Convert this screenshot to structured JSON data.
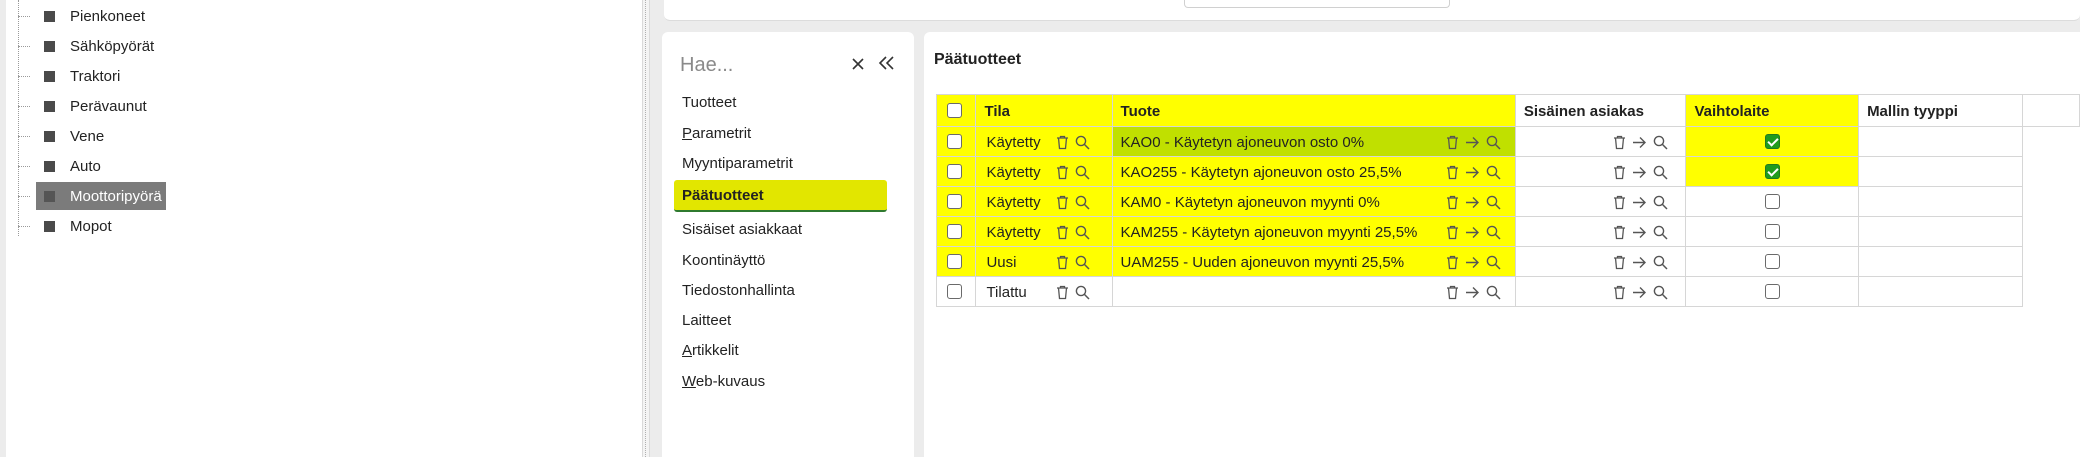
{
  "tree": {
    "items": [
      {
        "label": "Pienkoneet",
        "selected": false
      },
      {
        "label": "Sähköpyörät",
        "selected": false
      },
      {
        "label": "Traktori",
        "selected": false
      },
      {
        "label": "Perävaunut",
        "selected": false
      },
      {
        "label": "Vene",
        "selected": false
      },
      {
        "label": "Auto",
        "selected": false
      },
      {
        "label": "Moottoripyörä",
        "selected": true
      },
      {
        "label": "Mopot",
        "selected": false
      }
    ]
  },
  "nav": {
    "search_placeholder": "Hae...",
    "clear_icon": "close-icon",
    "collapse_icon": "double-chevron-left-icon",
    "items": [
      {
        "label": "Tuotteet"
      },
      {
        "label": "Parametrit",
        "underline_first": true
      },
      {
        "label": "Myyntiparametrit"
      },
      {
        "label": "Päätuotteet",
        "active": true
      },
      {
        "label": "Sisäiset asiakkaat"
      },
      {
        "label": "Koontinäyttö"
      },
      {
        "label": "Tiedostonhallinta"
      },
      {
        "label": "Laitteet"
      },
      {
        "label": "Artikkelit",
        "underline_first": true
      },
      {
        "label": "Web-kuvaus",
        "underline_first": true
      }
    ],
    "active_color": "#e2e600"
  },
  "main": {
    "title": "Päätuotteet",
    "columns": [
      "Tila",
      "Tuote",
      "Sisäinen asiakas",
      "Vaihtolaite",
      "Mallin tyyppi"
    ],
    "rows": [
      {
        "tila": "Käytetty",
        "tuote": "KAO0 - Käytetyn ajoneuvon osto 0%",
        "vaihtolaite": true,
        "highlighted": true
      },
      {
        "tila": "Käytetty",
        "tuote": "KAO255 - Käytetyn ajoneuvon osto 25,5%",
        "vaihtolaite": true,
        "highlighted": true
      },
      {
        "tila": "Käytetty",
        "tuote": "KAM0 - Käytetyn ajoneuvon myynti 0%",
        "vaihtolaite": false,
        "highlighted": true
      },
      {
        "tila": "Käytetty",
        "tuote": "KAM255 - Käytetyn ajoneuvon myynti 25,5%",
        "vaihtolaite": false,
        "highlighted": true
      },
      {
        "tila": "Uusi",
        "tuote": "UAM255 - Uuden ajoneuvon myynti 25,5%",
        "vaihtolaite": false,
        "highlighted": true
      },
      {
        "tila": "Tilattu",
        "tuote": "",
        "vaihtolaite": false,
        "highlighted": false
      }
    ],
    "highlight_color": "#ffff00",
    "checked_color": "#1f9b1f"
  }
}
